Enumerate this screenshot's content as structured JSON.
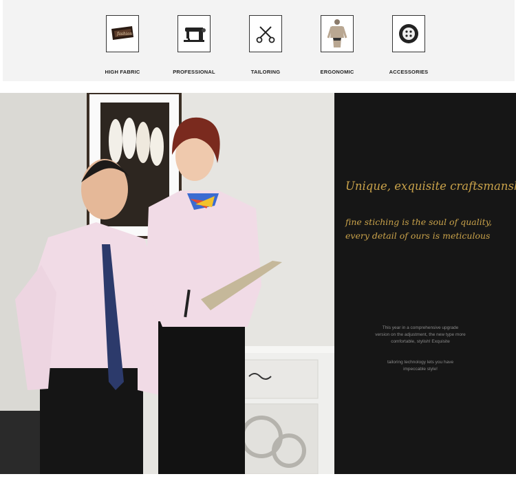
{
  "features": [
    {
      "label": "HIGH FABRIC",
      "icon": "fabric-tag-icon",
      "tag_text": "fashion"
    },
    {
      "label": "PROFESSIONAL",
      "icon": "sewing-machine-icon"
    },
    {
      "label": "TAILORING",
      "icon": "scissors-icon"
    },
    {
      "label": "ERGONOMIC",
      "icon": "body-figure-icon"
    },
    {
      "label": "ACCESSORIES",
      "icon": "button-icon"
    }
  ],
  "panel": {
    "headline": "Unique, exquisite craftsmanship",
    "sub_line1": "fine stiching is the soul of quality,",
    "sub_line2": "every detail of ours is meticulous",
    "small1": [
      "This year in a comprehensive upgrade",
      "version on the adjustment, the new type more",
      "comfortable, stylish! Exquisite"
    ],
    "small2": [
      "tailoring technology lets you have",
      "impeccable style!"
    ]
  },
  "colors": {
    "gold": "#c9a24a",
    "panel_bg": "#161616",
    "shirt_pink": "#f1dbe6",
    "tie_navy": "#2c3a6b"
  }
}
